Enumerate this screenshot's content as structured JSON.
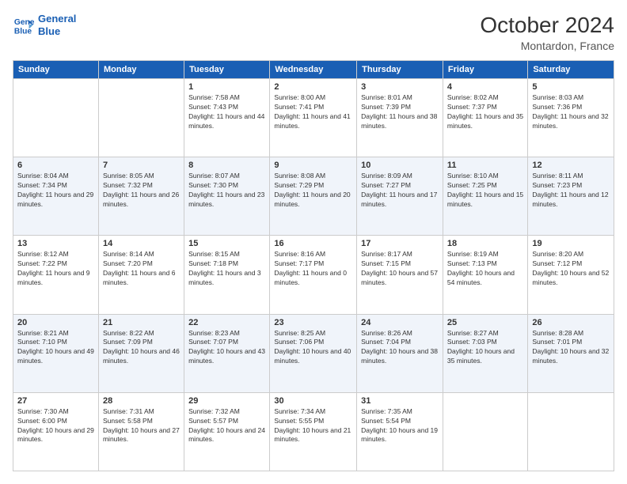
{
  "logo": {
    "line1": "General",
    "line2": "Blue"
  },
  "header": {
    "month": "October 2024",
    "location": "Montardon, France"
  },
  "weekdays": [
    "Sunday",
    "Monday",
    "Tuesday",
    "Wednesday",
    "Thursday",
    "Friday",
    "Saturday"
  ],
  "weeks": [
    [
      {
        "day": "",
        "sunrise": "",
        "sunset": "",
        "daylight": ""
      },
      {
        "day": "",
        "sunrise": "",
        "sunset": "",
        "daylight": ""
      },
      {
        "day": "1",
        "sunrise": "Sunrise: 7:58 AM",
        "sunset": "Sunset: 7:43 PM",
        "daylight": "Daylight: 11 hours and 44 minutes."
      },
      {
        "day": "2",
        "sunrise": "Sunrise: 8:00 AM",
        "sunset": "Sunset: 7:41 PM",
        "daylight": "Daylight: 11 hours and 41 minutes."
      },
      {
        "day": "3",
        "sunrise": "Sunrise: 8:01 AM",
        "sunset": "Sunset: 7:39 PM",
        "daylight": "Daylight: 11 hours and 38 minutes."
      },
      {
        "day": "4",
        "sunrise": "Sunrise: 8:02 AM",
        "sunset": "Sunset: 7:37 PM",
        "daylight": "Daylight: 11 hours and 35 minutes."
      },
      {
        "day": "5",
        "sunrise": "Sunrise: 8:03 AM",
        "sunset": "Sunset: 7:36 PM",
        "daylight": "Daylight: 11 hours and 32 minutes."
      }
    ],
    [
      {
        "day": "6",
        "sunrise": "Sunrise: 8:04 AM",
        "sunset": "Sunset: 7:34 PM",
        "daylight": "Daylight: 11 hours and 29 minutes."
      },
      {
        "day": "7",
        "sunrise": "Sunrise: 8:05 AM",
        "sunset": "Sunset: 7:32 PM",
        "daylight": "Daylight: 11 hours and 26 minutes."
      },
      {
        "day": "8",
        "sunrise": "Sunrise: 8:07 AM",
        "sunset": "Sunset: 7:30 PM",
        "daylight": "Daylight: 11 hours and 23 minutes."
      },
      {
        "day": "9",
        "sunrise": "Sunrise: 8:08 AM",
        "sunset": "Sunset: 7:29 PM",
        "daylight": "Daylight: 11 hours and 20 minutes."
      },
      {
        "day": "10",
        "sunrise": "Sunrise: 8:09 AM",
        "sunset": "Sunset: 7:27 PM",
        "daylight": "Daylight: 11 hours and 17 minutes."
      },
      {
        "day": "11",
        "sunrise": "Sunrise: 8:10 AM",
        "sunset": "Sunset: 7:25 PM",
        "daylight": "Daylight: 11 hours and 15 minutes."
      },
      {
        "day": "12",
        "sunrise": "Sunrise: 8:11 AM",
        "sunset": "Sunset: 7:23 PM",
        "daylight": "Daylight: 11 hours and 12 minutes."
      }
    ],
    [
      {
        "day": "13",
        "sunrise": "Sunrise: 8:12 AM",
        "sunset": "Sunset: 7:22 PM",
        "daylight": "Daylight: 11 hours and 9 minutes."
      },
      {
        "day": "14",
        "sunrise": "Sunrise: 8:14 AM",
        "sunset": "Sunset: 7:20 PM",
        "daylight": "Daylight: 11 hours and 6 minutes."
      },
      {
        "day": "15",
        "sunrise": "Sunrise: 8:15 AM",
        "sunset": "Sunset: 7:18 PM",
        "daylight": "Daylight: 11 hours and 3 minutes."
      },
      {
        "day": "16",
        "sunrise": "Sunrise: 8:16 AM",
        "sunset": "Sunset: 7:17 PM",
        "daylight": "Daylight: 11 hours and 0 minutes."
      },
      {
        "day": "17",
        "sunrise": "Sunrise: 8:17 AM",
        "sunset": "Sunset: 7:15 PM",
        "daylight": "Daylight: 10 hours and 57 minutes."
      },
      {
        "day": "18",
        "sunrise": "Sunrise: 8:19 AM",
        "sunset": "Sunset: 7:13 PM",
        "daylight": "Daylight: 10 hours and 54 minutes."
      },
      {
        "day": "19",
        "sunrise": "Sunrise: 8:20 AM",
        "sunset": "Sunset: 7:12 PM",
        "daylight": "Daylight: 10 hours and 52 minutes."
      }
    ],
    [
      {
        "day": "20",
        "sunrise": "Sunrise: 8:21 AM",
        "sunset": "Sunset: 7:10 PM",
        "daylight": "Daylight: 10 hours and 49 minutes."
      },
      {
        "day": "21",
        "sunrise": "Sunrise: 8:22 AM",
        "sunset": "Sunset: 7:09 PM",
        "daylight": "Daylight: 10 hours and 46 minutes."
      },
      {
        "day": "22",
        "sunrise": "Sunrise: 8:23 AM",
        "sunset": "Sunset: 7:07 PM",
        "daylight": "Daylight: 10 hours and 43 minutes."
      },
      {
        "day": "23",
        "sunrise": "Sunrise: 8:25 AM",
        "sunset": "Sunset: 7:06 PM",
        "daylight": "Daylight: 10 hours and 40 minutes."
      },
      {
        "day": "24",
        "sunrise": "Sunrise: 8:26 AM",
        "sunset": "Sunset: 7:04 PM",
        "daylight": "Daylight: 10 hours and 38 minutes."
      },
      {
        "day": "25",
        "sunrise": "Sunrise: 8:27 AM",
        "sunset": "Sunset: 7:03 PM",
        "daylight": "Daylight: 10 hours and 35 minutes."
      },
      {
        "day": "26",
        "sunrise": "Sunrise: 8:28 AM",
        "sunset": "Sunset: 7:01 PM",
        "daylight": "Daylight: 10 hours and 32 minutes."
      }
    ],
    [
      {
        "day": "27",
        "sunrise": "Sunrise: 7:30 AM",
        "sunset": "Sunset: 6:00 PM",
        "daylight": "Daylight: 10 hours and 29 minutes."
      },
      {
        "day": "28",
        "sunrise": "Sunrise: 7:31 AM",
        "sunset": "Sunset: 5:58 PM",
        "daylight": "Daylight: 10 hours and 27 minutes."
      },
      {
        "day": "29",
        "sunrise": "Sunrise: 7:32 AM",
        "sunset": "Sunset: 5:57 PM",
        "daylight": "Daylight: 10 hours and 24 minutes."
      },
      {
        "day": "30",
        "sunrise": "Sunrise: 7:34 AM",
        "sunset": "Sunset: 5:55 PM",
        "daylight": "Daylight: 10 hours and 21 minutes."
      },
      {
        "day": "31",
        "sunrise": "Sunrise: 7:35 AM",
        "sunset": "Sunset: 5:54 PM",
        "daylight": "Daylight: 10 hours and 19 minutes."
      },
      {
        "day": "",
        "sunrise": "",
        "sunset": "",
        "daylight": ""
      },
      {
        "day": "",
        "sunrise": "",
        "sunset": "",
        "daylight": ""
      }
    ]
  ]
}
